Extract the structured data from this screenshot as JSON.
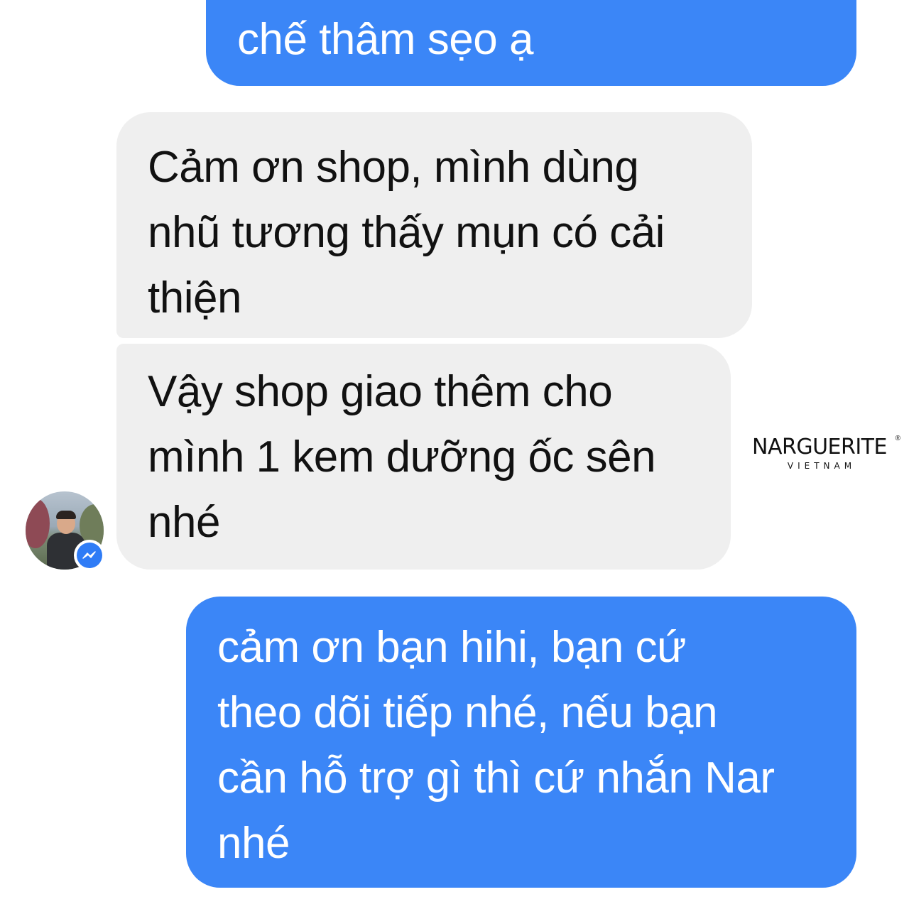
{
  "messages": [
    {
      "direction": "outgoing",
      "lines": [
        "chế thâm sẹo ạ"
      ]
    },
    {
      "direction": "incoming",
      "lines": [
        "Cảm ơn shop, mình dùng",
        "nhũ tương thấy mụn có cải",
        "thiện"
      ]
    },
    {
      "direction": "incoming",
      "lines": [
        "Vậy shop giao thêm cho",
        "mình 1 kem dưỡng ốc sên",
        "nhé"
      ]
    },
    {
      "direction": "outgoing",
      "lines": [
        "cảm ơn bạn hihi, bạn cứ",
        "theo dõi tiếp nhé, nếu bạn",
        "cần hỗ trợ gì thì cứ nhắn Nar",
        "nhé"
      ]
    }
  ],
  "watermark": {
    "name": "NARGUERITE",
    "sub": "VIETNAM",
    "reg": "®"
  },
  "colors": {
    "outgoing_bubble": "#3b86f7",
    "incoming_bubble": "#efefef",
    "messenger_badge": "#2f7cf6"
  },
  "icons": {
    "avatar": "user-avatar-photo",
    "badge": "messenger-icon"
  }
}
